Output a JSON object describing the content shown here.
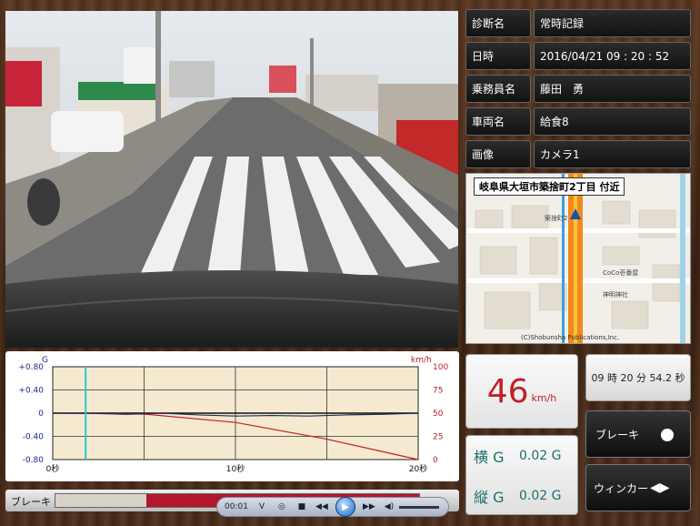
{
  "info": {
    "rows": [
      {
        "key": "診断名",
        "value": "常時記録"
      },
      {
        "key": "日時",
        "value": "2016/04/21  09 : 20 : 52"
      },
      {
        "key": "乗務員名",
        "value": "藤田　勇"
      },
      {
        "key": "車両名",
        "value": "給食8"
      },
      {
        "key": "画像",
        "value": "カメラ1"
      }
    ]
  },
  "map": {
    "location": "岐阜県大垣市築捨町2丁目 付近",
    "poi_1": "築捨町2",
    "poi_2": "CoCo壱番屋",
    "poi_3": "神明神社",
    "copyright": "(C)Shobunsha Publications,Inc."
  },
  "graph": {
    "left_unit": "G",
    "right_unit": "km/h",
    "x_ticks": [
      "0秒",
      "10秒",
      "20秒"
    ],
    "y_left_ticks": [
      "+0.80",
      "+0.40",
      "0",
      "-0.40",
      "-0.80"
    ],
    "y_right_ticks": [
      "100",
      "75",
      "50",
      "25",
      "0"
    ],
    "cursor_time": 1.8,
    "speed_series": [
      [
        0,
        50
      ],
      [
        5,
        49
      ],
      [
        10,
        40
      ],
      [
        15,
        22
      ],
      [
        20,
        0
      ]
    ],
    "g_series": [
      [
        0,
        0
      ],
      [
        2,
        0
      ],
      [
        4,
        -0.02
      ],
      [
        6,
        0
      ],
      [
        8,
        -0.03
      ],
      [
        10,
        -0.05
      ],
      [
        12,
        -0.04
      ],
      [
        14,
        -0.05
      ],
      [
        16,
        -0.03
      ],
      [
        18,
        -0.02
      ],
      [
        20,
        0
      ]
    ]
  },
  "speed": {
    "value": "46",
    "unit": "km/h"
  },
  "time_display": "09 時 20 分 54.2 秒",
  "buttons": {
    "brake": "ブレーキ",
    "winker": "ウィンカー"
  },
  "g_values": {
    "lateral_key": "横 G",
    "lateral_val": "0.02 G",
    "longitudinal_key": "縦 G",
    "longitudinal_val": "0.02 G"
  },
  "brake_bar": {
    "label": "ブレーキ",
    "progress": 0.25
  },
  "player": {
    "time": "00:01"
  },
  "colors": {
    "speed": "#c0202a",
    "cursor": "#1fd0d8",
    "graph_bg": "#f5e9cf"
  }
}
